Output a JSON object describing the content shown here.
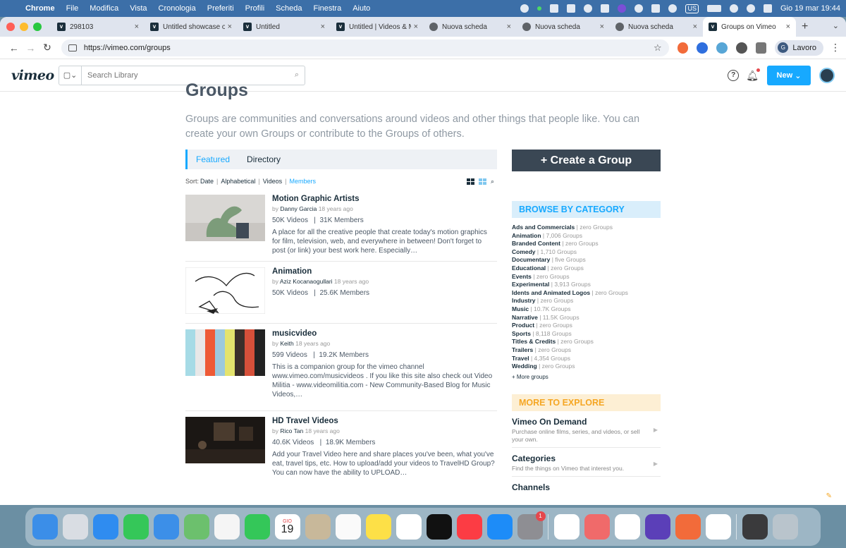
{
  "menubar": {
    "app": "Chrome",
    "items": [
      "File",
      "Modifica",
      "Vista",
      "Cronologia",
      "Preferiti",
      "Profili",
      "Scheda",
      "Finestra",
      "Aiuto"
    ],
    "input_source": "US",
    "datetime": "Gio 19 mar  19:44"
  },
  "browser": {
    "tabs": [
      {
        "label": "298103",
        "favicon": "vimeo-icon",
        "active": false
      },
      {
        "label": "Untitled showcase o",
        "favicon": "vimeo-icon",
        "active": false
      },
      {
        "label": "Untitled",
        "favicon": "vimeo-icon",
        "active": false
      },
      {
        "label": "Untitled | Videos & M",
        "favicon": "vimeo-icon",
        "active": false
      },
      {
        "label": "Nuova scheda",
        "favicon": "chrome-icon",
        "active": false
      },
      {
        "label": "Nuova scheda",
        "favicon": "chrome-icon",
        "active": false
      },
      {
        "label": "Nuova scheda",
        "favicon": "chrome-icon",
        "active": false
      },
      {
        "label": "Groups on Vimeo",
        "favicon": "vimeo-icon",
        "active": true
      }
    ],
    "url": "https://vimeo.com/groups",
    "profile_initial": "G",
    "profile_name": "Lavoro"
  },
  "vimeo": {
    "logo": "vimeo",
    "search_placeholder": "Search Library",
    "new_button": "New",
    "page_title": "Groups",
    "intro": "Groups are communities and conversations around videos and other things that people like. You can create your own Groups or contribute to the Groups of others.",
    "tabs": [
      "Featured",
      "Directory"
    ],
    "sort_label": "Sort:",
    "sort_options": [
      "Date",
      "Alphabetical",
      "Videos",
      "Members"
    ],
    "groups": [
      {
        "name": "Motion Graphic Artists",
        "by": "by",
        "author": "Danny Garcia",
        "age": "18 years ago",
        "videos": "50K Videos",
        "members": "31K Members",
        "description": "A place for all the creative people that create today's motion graphics for film, television, web, and everywhere in between! Don't forget to post (or link) your best work here. Especially…"
      },
      {
        "name": "Animation",
        "by": "by",
        "author": "Aziz Kocanaogullari",
        "age": "18 years ago",
        "videos": "50K Videos",
        "members": "25.6K Members",
        "description": ""
      },
      {
        "name": "musicvideo",
        "by": "by",
        "author": "Keith",
        "age": "18 years ago",
        "videos": "599 Videos",
        "members": "19.2K Members",
        "description": "This is a companion group for the vimeo channel www.vimeo.com/musicvideos . If you like this site also check out Video Militia - www.videomilitia.com - New Community-Based Blog for Music Videos,…"
      },
      {
        "name": "HD Travel Videos",
        "by": "by",
        "author": "Rico Tan",
        "age": "18 years ago",
        "videos": "40.6K Videos",
        "members": "18.9K Members",
        "description": "Add your Travel Video here and share places you've been, what you've eat, travel tips, etc. How to upload/add your videos to TravelHD Group? You can now have the ability to UPLOAD…"
      }
    ],
    "create_button": "+ Create a Group",
    "browse_heading": "BROWSE BY CATEGORY",
    "categories": [
      {
        "name": "Ads and Commercials",
        "count": "zero Groups"
      },
      {
        "name": "Animation",
        "count": "7,006 Groups"
      },
      {
        "name": "Branded Content",
        "count": "zero Groups"
      },
      {
        "name": "Comedy",
        "count": "1,710 Groups"
      },
      {
        "name": "Documentary",
        "count": "five Groups"
      },
      {
        "name": "Educational",
        "count": "zero Groups"
      },
      {
        "name": "Events",
        "count": "zero Groups"
      },
      {
        "name": "Experimental",
        "count": "3,913 Groups"
      },
      {
        "name": "Idents and Animated Logos",
        "count": "zero Groups"
      },
      {
        "name": "Industry",
        "count": "zero Groups"
      },
      {
        "name": "Music",
        "count": "10.7K Groups"
      },
      {
        "name": "Narrative",
        "count": "11.5K Groups"
      },
      {
        "name": "Product",
        "count": "zero Groups"
      },
      {
        "name": "Sports",
        "count": "8,118 Groups"
      },
      {
        "name": "Titles & Credits",
        "count": "zero Groups"
      },
      {
        "name": "Trailers",
        "count": "zero Groups"
      },
      {
        "name": "Travel",
        "count": "4,354 Groups"
      },
      {
        "name": "Wedding",
        "count": "zero Groups"
      }
    ],
    "more_groups": "+ More groups",
    "explore_heading": "MORE TO EXPLORE",
    "explore": [
      {
        "name": "Vimeo On Demand",
        "desc": "Purchase online films, series, and videos, or sell your own."
      },
      {
        "name": "Categories",
        "desc": "Find the things on Vimeo that interest you."
      },
      {
        "name": "Channels",
        "desc": ""
      }
    ]
  },
  "dock": {
    "calendar_month": "GIO",
    "calendar_day": "19",
    "settings_badge": "1"
  }
}
